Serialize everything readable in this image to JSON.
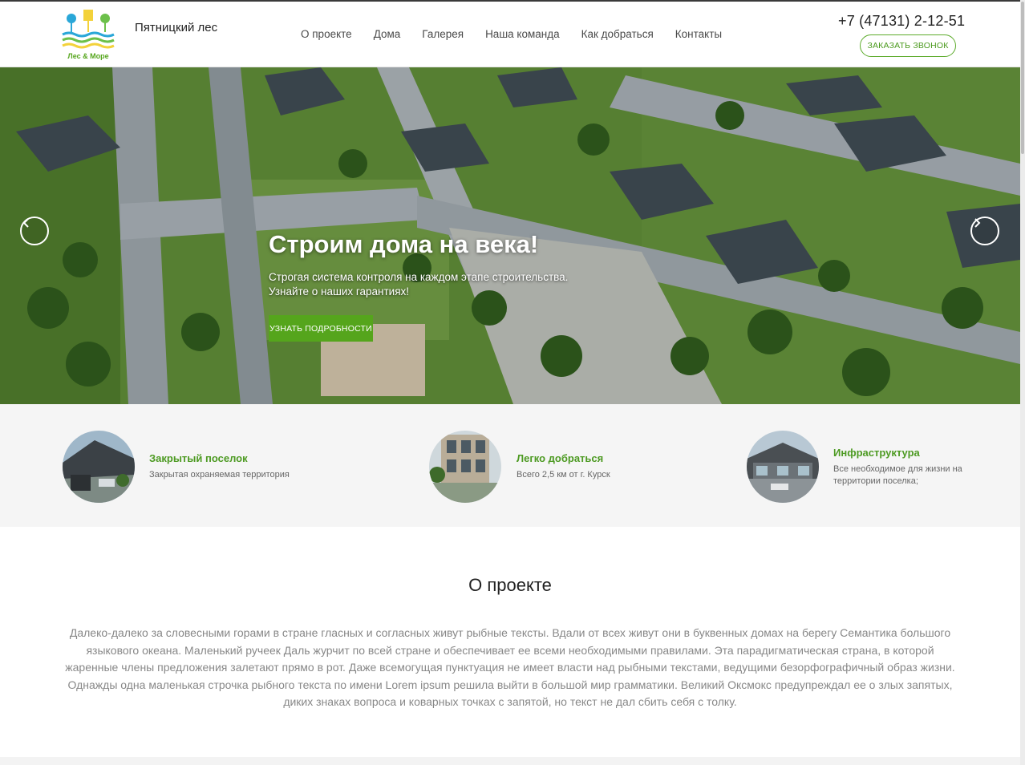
{
  "header": {
    "logo_text": "Лес & Море",
    "site_name": "Пятницкий лес",
    "nav": [
      "О проекте",
      "Дома",
      "Галерея",
      "Наша команда",
      "Как добраться",
      "Контакты"
    ],
    "phone": "+7 (47131) 2-12-51",
    "callback_label": "заказать звонок"
  },
  "hero": {
    "title": "Строим дома на века!",
    "text": "Строгая система контроля на каждом этапе строительства. Узнайте о наших гарантиях!",
    "button": "Узнать подробности",
    "prev_icon": "chevron-left-icon",
    "next_icon": "chevron-right-icon"
  },
  "features": [
    {
      "title": "Закрытый поселок",
      "desc": "Закрытая охраняемая территория"
    },
    {
      "title": "Легко добраться",
      "desc": "Всего 2,5 км от г. Курск"
    },
    {
      "title": "Инфраструктура",
      "desc": "Все необходимое для жизни на территории поселка;"
    }
  ],
  "about": {
    "title": "О проекте",
    "text": "Далеко-далеко за словесными горами в стране гласных и согласных живут рыбные тексты. Вдали от всех живут они в буквенных домах на берегу Семантика большого языкового океана. Маленький ручеек Даль журчит по всей стране и обеспечивает ее всеми необходимыми правилами. Эта парадигматическая страна, в которой жаренные члены предложения залетают прямо в рот. Даже всемогущая пунктуация не имеет власти над рыбными текстами, ведущими безорфографичный образ жизни. Однажды одна маленькая строчка рыбного текста по имени Lorem ipsum решила выйти в большой мир грамматики. Великий Оксмокс предупреждал ее о злых запятых, диких знаках вопроса и коварных точках с запятой, но текст не дал сбить себя с толку."
  },
  "colors": {
    "accent": "#55a51c",
    "accent_text": "#4d9a22",
    "body_text": "#888888"
  }
}
